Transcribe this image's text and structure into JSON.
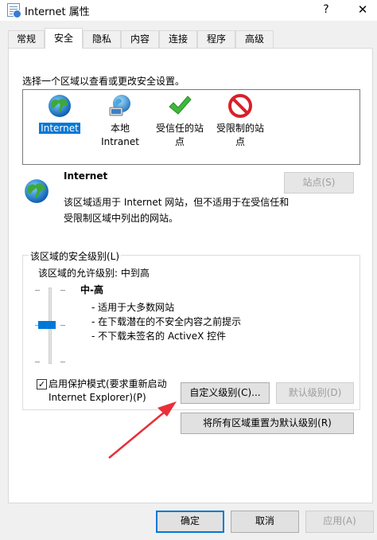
{
  "window": {
    "title": "Internet 属性",
    "help_glyph": "?",
    "close_glyph": "✕"
  },
  "tabs": [
    {
      "label": "常规"
    },
    {
      "label": "安全"
    },
    {
      "label": "隐私"
    },
    {
      "label": "内容"
    },
    {
      "label": "连接"
    },
    {
      "label": "程序"
    },
    {
      "label": "高级"
    }
  ],
  "active_tab": "安全",
  "zones": {
    "caption": "选择一个区域以查看或更改安全设置。",
    "items": [
      {
        "label": "Internet",
        "icon": "globe-icon",
        "selected": true
      },
      {
        "label_line1": "本地",
        "label_line2": "Intranet",
        "icon": "intranet-globe-icon"
      },
      {
        "label_line1": "受信任的站",
        "label_line2": "点",
        "icon": "checkmark-icon"
      },
      {
        "label_line1": "受限制的站",
        "label_line2": "点",
        "icon": "restricted-icon"
      }
    ]
  },
  "zone_info": {
    "title": "Internet",
    "description": "该区域适用于 Internet 网站，但不适用于在受信任和受限制区域中列出的网站。",
    "sites_button": "站点(S)"
  },
  "security_level": {
    "group_title": "该区域的安全级别(L)",
    "allowed_levels": "该区域的允许级别: 中到高",
    "level_name": "中-高",
    "level_details": [
      "- 适用于大多数网站",
      "- 在下载潜在的不安全内容之前提示",
      "- 不下载未签名的 ActiveX 控件"
    ],
    "slider_level": "中-高",
    "protected_mode": {
      "checked": true,
      "label_line1": "启用保护模式(要求重新启动",
      "label_line2": "Internet Explorer)(P)"
    },
    "custom_level_button": "自定义级别(C)...",
    "default_level_button": "默认级别(D)",
    "reset_all_button": "将所有区域重置为默认级别(R)"
  },
  "footer": {
    "ok": "确定",
    "cancel": "取消",
    "apply": "应用(A)"
  },
  "colors": {
    "accent": "#0078d7",
    "annotation_arrow": "#e8303a"
  }
}
